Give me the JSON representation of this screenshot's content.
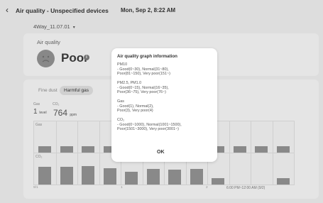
{
  "header": {
    "back_icon": "chevron-left-icon",
    "title": "Air quality - Unspecified devices",
    "datetime": "Mon, Sep 2, 8:22 AM"
  },
  "device_selector": {
    "label": "4Way_11.07.01",
    "caret": "▾"
  },
  "status_card": {
    "label": "Air quality",
    "status": "Poor",
    "info_glyph": "i"
  },
  "filters": {
    "fine_dust": "Fine dust",
    "harmful_gas": "Harmful gas"
  },
  "readings": {
    "gas_label": "Gas",
    "co2_label": "CO₂",
    "gas_value": "1",
    "gas_unit": "level",
    "co2_value": "764",
    "co2_unit": "ppm"
  },
  "chart": {
    "gas_row_label": "Gas",
    "co2_row_label": "CO₂",
    "x_labels": [
      "9/1",
      "1",
      "2"
    ],
    "time_range": "6:00 PM~12:00 AM (9/2)",
    "gas_bars": [
      1,
      1,
      1,
      1,
      1,
      1,
      1,
      1,
      1,
      1,
      1,
      1
    ],
    "co2_bars": [
      0.62,
      0.62,
      0.65,
      0.58,
      0.45,
      0.55,
      0.52,
      0.55,
      0.22,
      0,
      0,
      0.22
    ]
  },
  "dialog": {
    "title": "Air quality graph information",
    "lines": [
      "PM10",
      "- Good(0~30), Normal(31~80),",
      "  Poor(81~150), Very poor(151~)",
      "PM2.5, PM1.0",
      "- Good(0~15), Normal(16~35),",
      "  Poor(36~75), Very poor(76~)",
      "Gas",
      "- Good(1), Normal(2),",
      "  Poor(3), Very poor(4)",
      "CO₂",
      "- Good(0~1000), Normal(1001~1500),",
      "  Poor(1501~3000), Very poor(3001~)"
    ],
    "ok": "OK"
  }
}
